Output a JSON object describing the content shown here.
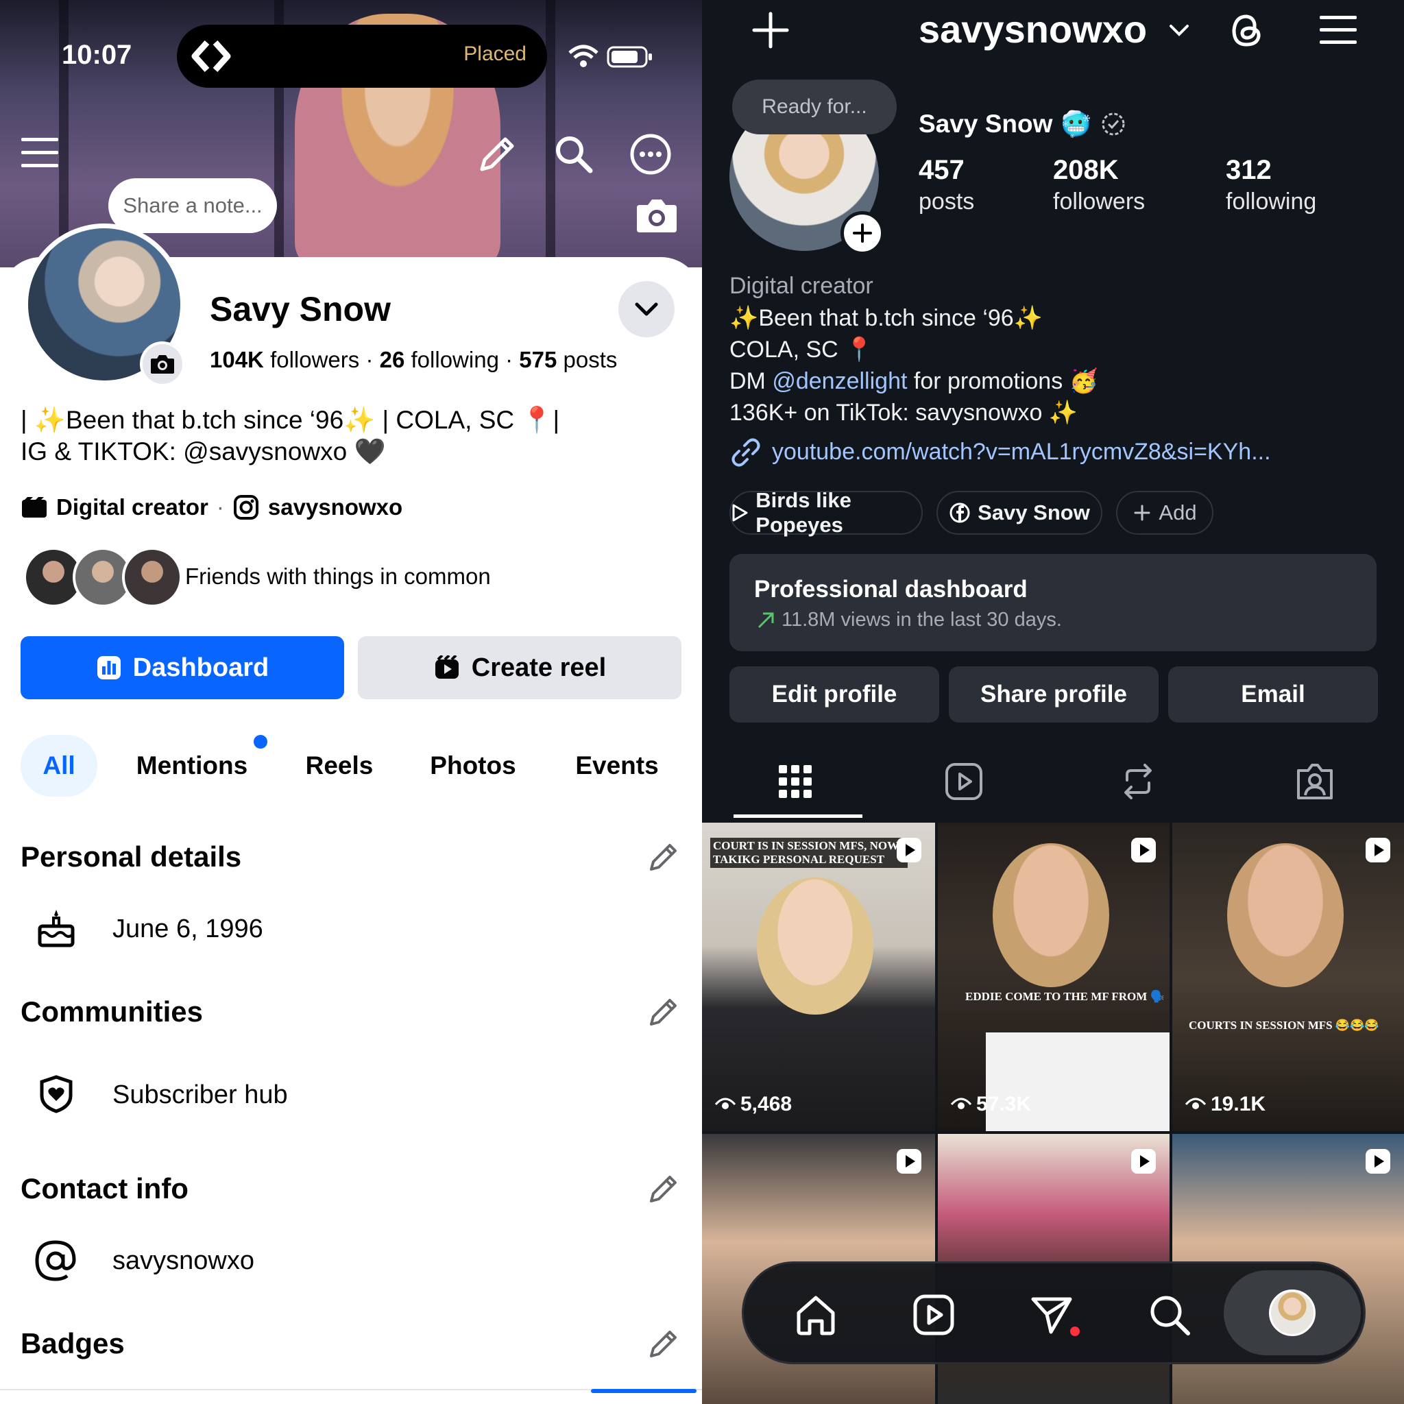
{
  "status_bar": {
    "time": "10:07",
    "activity": "Placed"
  },
  "facebook": {
    "note_bubble": "Share a note...",
    "name": "Savy Snow",
    "stats": {
      "followers": "104K",
      "followers_label": "followers",
      "following": "26",
      "following_label": "following",
      "posts": "575",
      "posts_label": "posts",
      "sep": "·"
    },
    "bio_line1": "| ✨Been that b.tch since ‘96✨ | COLA, SC 📍|",
    "bio_line2": "IG & TIKTOK: @savysnowxo 🖤",
    "category": "Digital creator",
    "category_sep": "·",
    "instagram_handle": "savysnowxo",
    "friends_text": "Friends with things in common",
    "dashboard_button": "Dashboard",
    "create_reel_button": "Create reel",
    "tabs": [
      "All",
      "Mentions",
      "Reels",
      "Photos",
      "Events"
    ],
    "sections": {
      "personal_details": "Personal details",
      "birthday": "June 6, 1996",
      "communities": "Communities",
      "subscriber_hub": "Subscriber hub",
      "contact_info": "Contact info",
      "contact_handle": "savysnowxo",
      "badges": "Badges"
    },
    "colors": {
      "accent": "#0866ff"
    }
  },
  "instagram": {
    "username": "savysnowxo",
    "note_bubble": "Ready for...",
    "display_name": "Savy Snow",
    "name_emoji": "🥶",
    "stats": [
      {
        "value": "457",
        "label": "posts"
      },
      {
        "value": "208K",
        "label": "followers"
      },
      {
        "value": "312",
        "label": "following"
      }
    ],
    "category": "Digital creator",
    "bio": [
      "✨Been that b.tch since ‘96✨",
      "COLA, SC 📍"
    ],
    "dm_prefix": "DM",
    "dm_mention": "@denzellight",
    "dm_suffix": "for promotions 🥳",
    "tiktok_line": "136K+ on TikTok: savysnowxo ✨",
    "link": "youtube.com/watch?v=mAL1rycmvZ8&si=KYh...",
    "pills": [
      "Birds like Popeyes",
      "Savy Snow",
      "Add"
    ],
    "dashboard": {
      "title": "Professional dashboard",
      "stat": "11.8M views in the last 30 days."
    },
    "buttons": [
      "Edit profile",
      "Share profile",
      "Email"
    ],
    "posts": [
      {
        "caption": "COURT IS IN SESSION MFS, NOW TAKIKG PERSONAL REQUEST",
        "views": "5,468"
      },
      {
        "caption": "EDDIE COME TO THE MF FROM 🗣️",
        "views": "57.3K"
      },
      {
        "caption": "COURTS IN SESSION MFS 😂😂😂",
        "views": "19.1K"
      },
      {
        "caption": "",
        "views": ""
      },
      {
        "caption": "",
        "views": ""
      },
      {
        "caption": "",
        "views": ""
      }
    ],
    "colors": {
      "link": "#a3c6ff",
      "background": "#11161d"
    }
  }
}
